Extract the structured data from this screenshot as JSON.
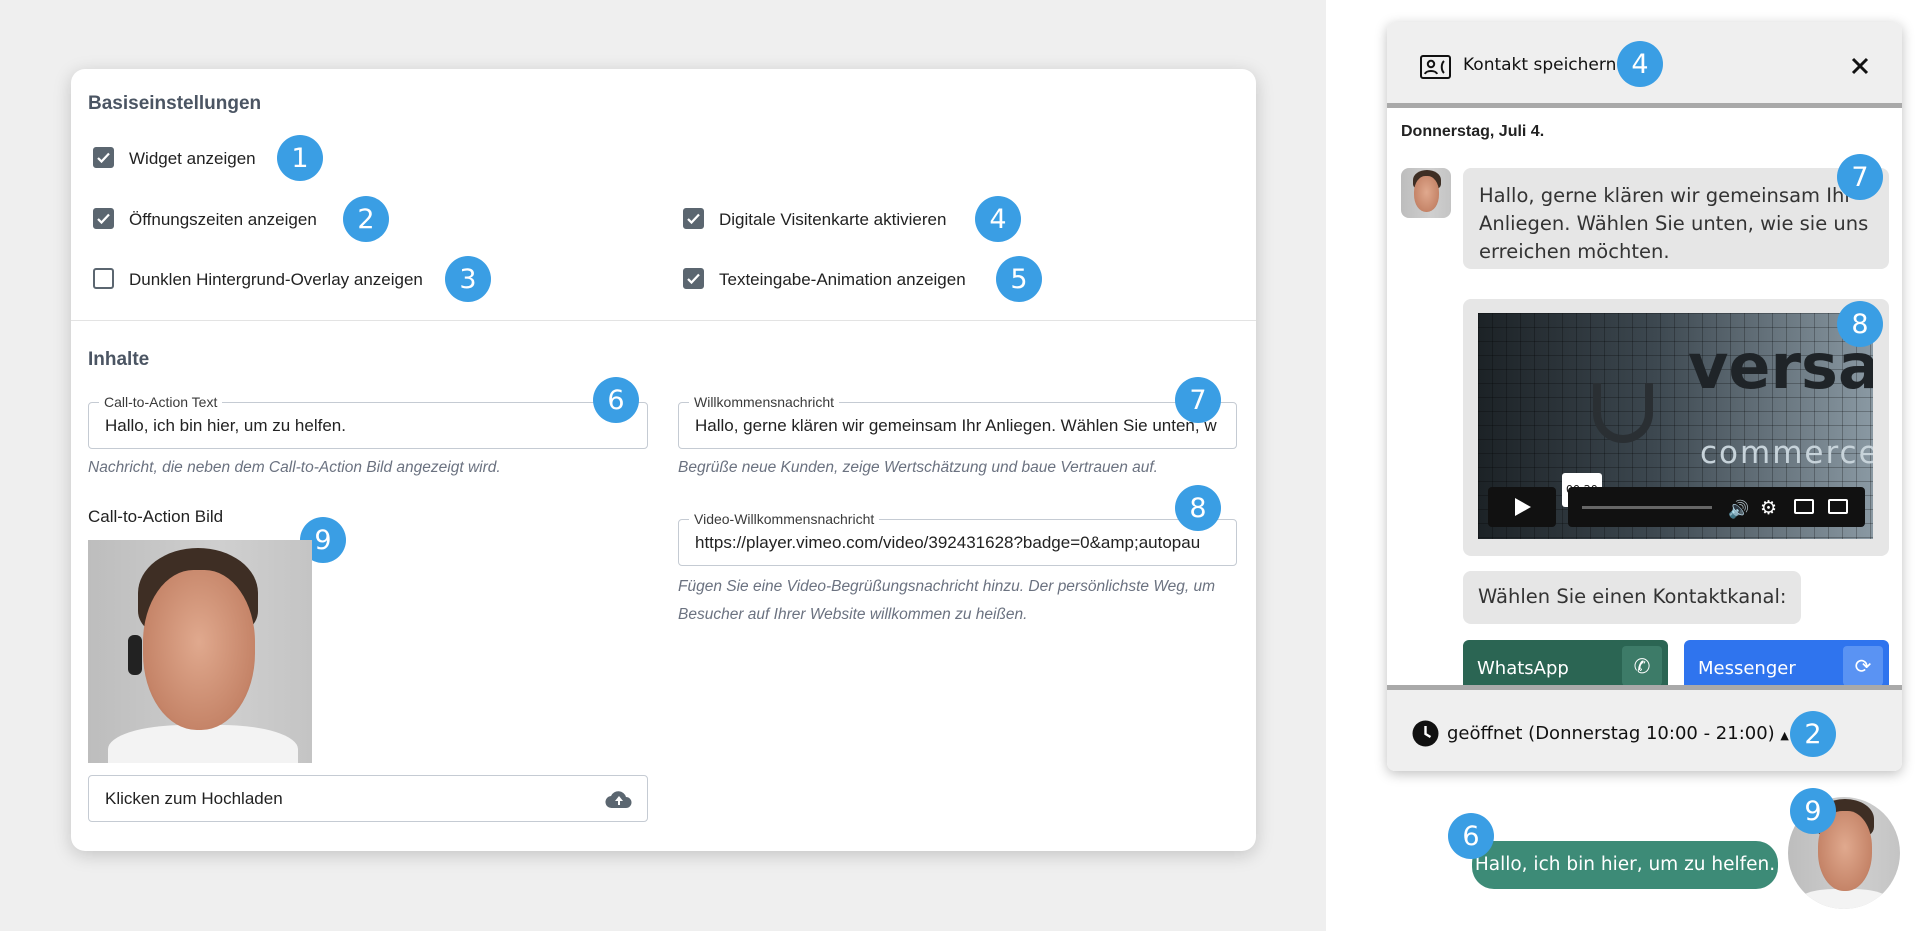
{
  "settings": {
    "basic_heading": "Basiseinstellungen",
    "checkboxes": [
      {
        "label": "Widget anzeigen",
        "checked": true,
        "badge": "1"
      },
      {
        "label": "Öffnungszeiten anzeigen",
        "checked": true,
        "badge": "2"
      },
      {
        "label": "Dunklen Hintergrund-Overlay anzeigen",
        "checked": false,
        "badge": "3"
      },
      {
        "label": "Digitale Visitenkarte aktivieren",
        "checked": true,
        "badge": "4"
      },
      {
        "label": "Texteingabe-Animation anzeigen",
        "checked": true,
        "badge": "5"
      }
    ],
    "content_heading": "Inhalte",
    "cta_text": {
      "label": "Call-to-Action Text",
      "value": "Hallo, ich bin hier, um zu helfen.",
      "help": "Nachricht, die neben dem Call-to-Action Bild angezeigt wird.",
      "badge": "6"
    },
    "welcome": {
      "label": "Willkommensnachricht",
      "value": "Hallo, gerne klären wir gemeinsam Ihr Anliegen. Wählen Sie unten, w",
      "help": "Begrüße neue Kunden, zeige Wertschätzung und baue Vertrauen auf.",
      "badge": "7"
    },
    "video": {
      "label": "Video-Willkommensnachricht",
      "value": "https://player.vimeo.com/video/392431628?badge=0&amp;autopau",
      "help": "Fügen Sie eine Video-Begrüßungsnachricht hinzu. Der persönlichste Weg, um Besucher auf Ihrer Website willkommen zu heißen.",
      "badge": "8"
    },
    "cta_image": {
      "label": "Call-to-Action Bild",
      "badge": "9",
      "upload_label": "Klicken zum Hochladen"
    }
  },
  "preview": {
    "header": {
      "save_contact": "Kontakt speichern",
      "badge": "4"
    },
    "date": "Donnerstag, Juli 4.",
    "welcome_message": "Hallo, gerne klären wir gemeinsam Ihr Anliegen. Wählen Sie unten, wie sie uns erreichen möchten.",
    "welcome_badge": "7",
    "video": {
      "brand": "versa",
      "brand_sub": "commerce",
      "time": "00:20",
      "badge": "8"
    },
    "channel_prompt": "Wählen Sie einen Kontaktkanal:",
    "channels": [
      {
        "label": "WhatsApp",
        "color": "#2b6553"
      },
      {
        "label": "Messenger",
        "color": "#2f74ee"
      }
    ],
    "footer": {
      "status": "geöffnet (Donnerstag 10:00 - 21:00)",
      "badge": "2"
    },
    "cta_bubble": "Hallo, ich bin hier, um zu helfen.",
    "cta_badge": "6",
    "avatar_badge": "9"
  },
  "colors": {
    "badge": "#3a9ee4",
    "cta_green": "#3d8b77",
    "checkbox": "#5b6670"
  }
}
